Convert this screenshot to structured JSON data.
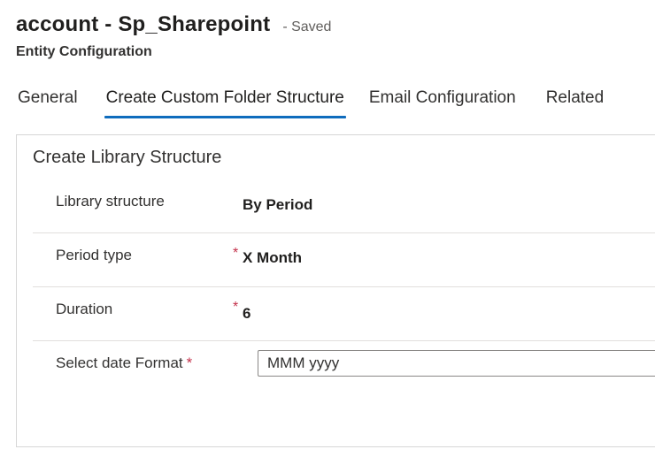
{
  "header": {
    "record_title": "account - Sp_Sharepoint",
    "save_status": "- Saved",
    "entity_name": "Entity Configuration"
  },
  "tabs": [
    {
      "label": "General",
      "active": false
    },
    {
      "label": "Create Custom Folder Structure",
      "active": true
    },
    {
      "label": "Email Configuration",
      "active": false
    },
    {
      "label": "Related",
      "active": false
    }
  ],
  "section": {
    "title": "Create Library Structure",
    "fields": [
      {
        "label": "Library structure",
        "value": "By Period",
        "required": false
      },
      {
        "label": "Period type",
        "value": "X Month",
        "required": true,
        "required_mark": "*"
      },
      {
        "label": "Duration",
        "value": "6",
        "required": true,
        "required_mark": "*"
      },
      {
        "label": "Select date Format",
        "value": "MMM yyyy",
        "required": true,
        "required_mark": "*"
      }
    ]
  },
  "colors": {
    "accent": "#0f6cbd",
    "required": "#c4314b",
    "divider": "#e1dfdd"
  }
}
